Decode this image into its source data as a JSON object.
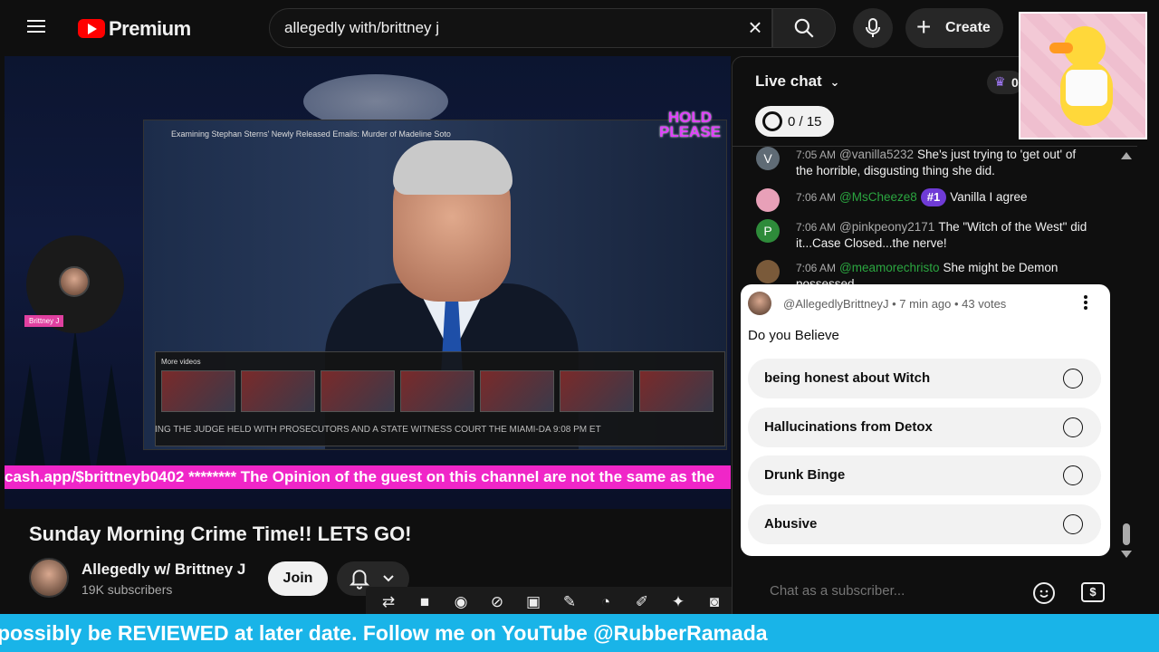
{
  "header": {
    "brand": "Premium",
    "search": {
      "value": "allegedly with/brittney j",
      "placeholder": "Search"
    },
    "create_label": "Create"
  },
  "video": {
    "inner_title": "Examining Stephan Sterns' Newly Released Emails: Murder of Madeline Soto",
    "hold_please": "HOLD PLEASE",
    "more_videos_label": "More videos",
    "inner_ticker": "ING THE JUDGE HELD WITH PROSECUTORS AND A STATE WITNESS   COURT   THE MIAMI-DA   9:08 PM ET",
    "guest_tag": "Brittney J",
    "marquee": "cash.app/$brittneyb0402 ******** The Opinion of the guest on this channel are not the same as the"
  },
  "meta": {
    "title": "Sunday Morning Crime Time!! LETS GO!",
    "channel_name": "Allegedly w/ Brittney J",
    "subscribers": "19K subscribers",
    "join_label": "Join"
  },
  "chat": {
    "header": "Live chat",
    "goal": "0 / 15",
    "crown_count": "0",
    "messages": [
      {
        "avatar_letter": "V",
        "avatar_color": "#5f6b75",
        "time": "7:05 AM",
        "author": "@vanilla5232",
        "member": false,
        "chip": "",
        "text": "She's just trying to 'get out' of the horrible, disgusting thing she did."
      },
      {
        "avatar_letter": "",
        "avatar_color": "#e8a0b8",
        "time": "7:06 AM",
        "author": "@MsCheeze8",
        "member": true,
        "chip": "#1",
        "text": "Vanilla I agree"
      },
      {
        "avatar_letter": "P",
        "avatar_color": "#2e8b3a",
        "time": "7:06 AM",
        "author": "@pinkpeony2171",
        "member": false,
        "chip": "",
        "text": "The \"Witch of the West\" did it...Case Closed...the nerve!"
      },
      {
        "avatar_letter": "",
        "avatar_color": "#7a5a3a",
        "time": "7:06 AM",
        "author": "@meamorechristo",
        "member": true,
        "chip": "",
        "text": "She might be Demon possessed"
      }
    ],
    "input_placeholder": "Chat as a subscriber..."
  },
  "poll": {
    "meta": "@AllegedlyBrittneyJ • 7 min ago • 43 votes",
    "question": "Do you Believe",
    "options": [
      {
        "label": "being honest about Witch"
      },
      {
        "label": "Hallucinations from Detox"
      },
      {
        "label": "Drunk Binge"
      },
      {
        "label": "Abusive"
      }
    ]
  },
  "ticker": {
    "text": "possibly be REVIEWED at later date. Follow me on YouTube @RubberRamada"
  },
  "colors": {
    "accent": "#ff0000",
    "marquee": "#f026c8",
    "ticker": "#19b4e8",
    "member_name": "#2ba640",
    "rank_chip": "#6f3bd6"
  }
}
